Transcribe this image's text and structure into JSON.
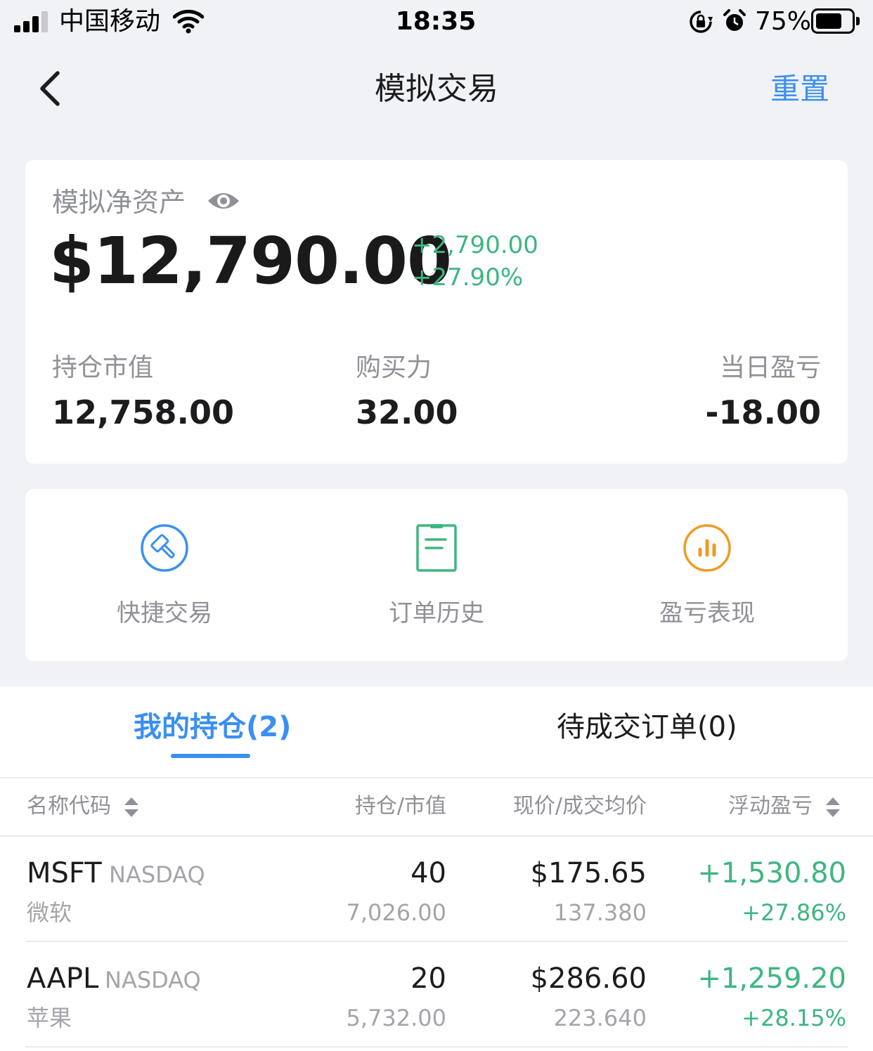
{
  "status_bar": {
    "carrier": "中国移动",
    "time": "18:35",
    "battery_percent": "75%",
    "battery_level": 0.75
  },
  "nav": {
    "title": "模拟交易",
    "reset": "重置"
  },
  "summary": {
    "net_assets_label": "模拟净资产",
    "net_assets_value": "$12,790.00",
    "change_amount": "+2,790.00",
    "change_percent": "+27.90%",
    "stats": [
      {
        "label": "持仓市值",
        "value": "12,758.00"
      },
      {
        "label": "购买力",
        "value": "32.00"
      },
      {
        "label": "当日盈亏",
        "value": "-18.00"
      }
    ]
  },
  "shortcuts": [
    {
      "label": "快捷交易",
      "icon": "hammer-icon",
      "color": "#3a8ff2"
    },
    {
      "label": "订单历史",
      "icon": "document-icon",
      "color": "#3db680"
    },
    {
      "label": "盈亏表现",
      "icon": "bar-chart-icon",
      "color": "#f09a25"
    }
  ],
  "tabs": [
    {
      "label": "我的持仓(2)",
      "active": true
    },
    {
      "label": "待成交订单(0)",
      "active": false
    }
  ],
  "table": {
    "headers": [
      "名称代码",
      "持仓/市值",
      "现价/成交均价",
      "浮动盈亏"
    ],
    "rows": [
      {
        "symbol": "MSFT",
        "exchange": "NASDAQ",
        "name": "微软",
        "quantity": "40",
        "market_value": "7,026.00",
        "price": "$175.65",
        "avg_cost": "137.380",
        "pnl": "+1,530.80",
        "pnl_pct": "+27.86%"
      },
      {
        "symbol": "AAPL",
        "exchange": "NASDAQ",
        "name": "苹果",
        "quantity": "20",
        "market_value": "5,732.00",
        "price": "$286.60",
        "avg_cost": "223.640",
        "pnl": "+1,259.20",
        "pnl_pct": "+28.15%"
      }
    ]
  },
  "colors": {
    "accent": "#3a8ff2",
    "gain": "#3db680",
    "orange": "#f09a25",
    "background": "#f1f2f6"
  }
}
